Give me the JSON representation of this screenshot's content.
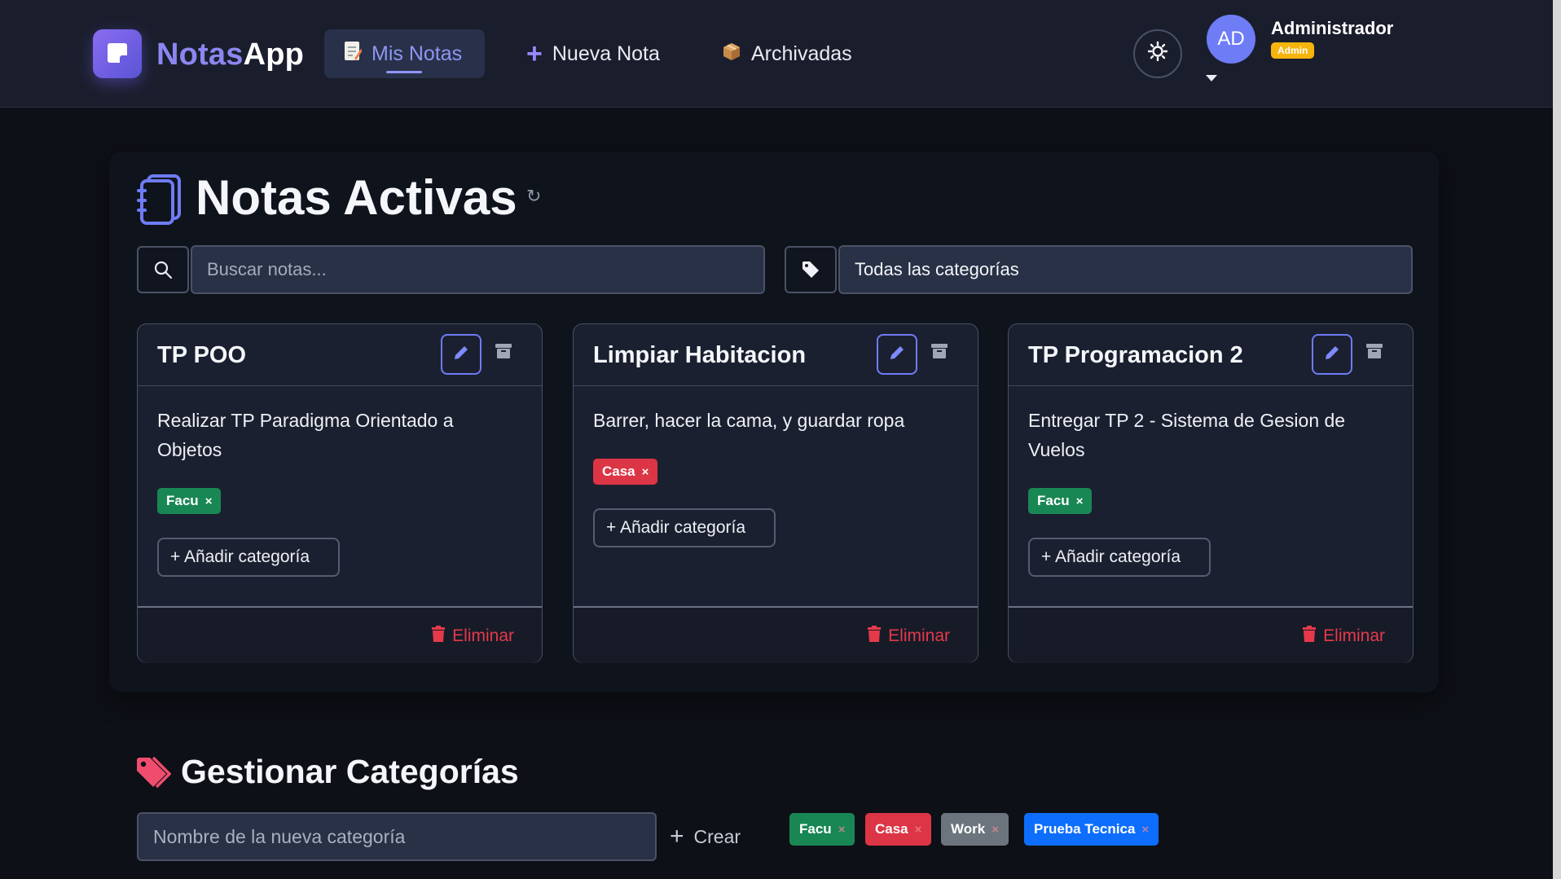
{
  "app": {
    "brand_part1": "Notas",
    "brand_part2": "App"
  },
  "nav": {
    "items": [
      {
        "label": "Mis Notas",
        "icon": "memo-icon",
        "active": true
      },
      {
        "label": "Nueva Nota",
        "icon": "plus-icon",
        "active": false
      },
      {
        "label": "Archivadas",
        "icon": "package-icon",
        "active": false
      }
    ]
  },
  "user": {
    "initials": "AD",
    "name": "Administrador",
    "role": "Admin"
  },
  "page": {
    "title": "Notas Activas"
  },
  "filters": {
    "search_placeholder": "Buscar notas...",
    "category_selected": "Todas las categorías"
  },
  "notes": [
    {
      "title": "TP POO",
      "body": "Realizar TP Paradigma Orientado a Objetos",
      "tags": [
        {
          "label": "Facu",
          "color": "#198754"
        }
      ],
      "add_category_label": "+ Añadir categoría",
      "delete_label": "Eliminar"
    },
    {
      "title": "Limpiar Habitacion",
      "body": "Barrer, hacer la cama, y guardar ropa",
      "tags": [
        {
          "label": "Casa",
          "color": "#dc3545"
        }
      ],
      "add_category_label": "+ Añadir categoría",
      "delete_label": "Eliminar"
    },
    {
      "title": "TP Programacion 2",
      "body": "Entregar TP 2 - Sistema de Gesion de Vuelos",
      "tags": [
        {
          "label": "Facu",
          "color": "#198754"
        }
      ],
      "add_category_label": "+ Añadir categoría",
      "delete_label": "Eliminar"
    }
  ],
  "categories_section": {
    "title": "Gestionar Categorías",
    "input_placeholder": "Nombre de la nueva categoría",
    "create_label": "Crear",
    "categories": [
      {
        "label": "Facu",
        "color": "#198754"
      },
      {
        "label": "Casa",
        "color": "#dc3545"
      },
      {
        "label": "Work",
        "color": "#6c757d"
      },
      {
        "label": "Prueba Tecnica",
        "color": "#0d6efd"
      }
    ]
  },
  "colors": {
    "accent": "#8f96f5",
    "danger": "#e5394a",
    "admin_badge": "#f7b40c"
  }
}
